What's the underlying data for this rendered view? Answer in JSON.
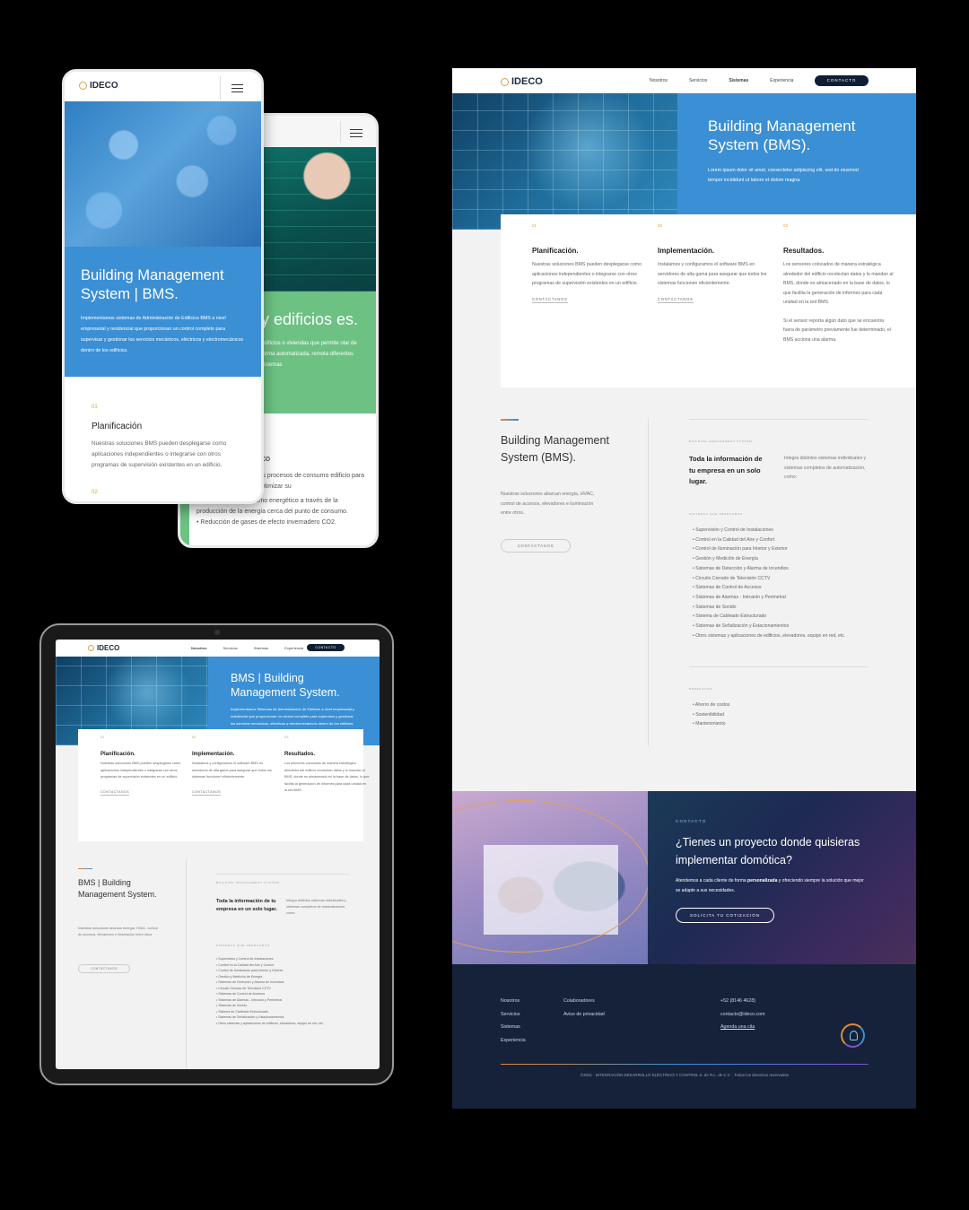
{
  "brand": {
    "logo_text": "IDECO"
  },
  "nav": {
    "links": [
      "Nosotros",
      "Servicios",
      "Sistemas",
      "Experiencia"
    ],
    "contact_button": "CONTACTO"
  },
  "phone_bms": {
    "title": "Building Management System | BMS.",
    "intro": "Implementamos sistemas de Administración de Edificios BMS a nivel empresarial y residencial que proporcionan un control completo para supervisar y gestionar los servicios mecánicos, eléctricos y electromecánicos dentro de los edificios.",
    "card_num_1": "01",
    "card_title": "Planificación",
    "card_text": "Nuestras soluciones BMS pueden desplegarse como aplicaciones independientes o integrarse con otros programas de supervisión existentes en un edificio.",
    "card_num_2": "02"
  },
  "phone_green": {
    "title": "y edificios es.",
    "intro": "edificios o viviendas que permite olar de forma automatizada, remota diferentes sistemas",
    "card_title": "tico",
    "card_text": "los procesos de consumo edificio para optimizar su",
    "bullets": [
      "Reducción del consumo energético a través de la producción de la energía cerca del punto de consumo.",
      "Reducción de gases de efecto invernadero CO2."
    ]
  },
  "tablet": {
    "hero_title": "BMS | Building Management System.",
    "hero_text": "Implementamos Sistemas de Administración de Edificios a nivel empresarial y residencial que proporcionan un control completo para supervisar y gestionar los servicios mecánicos, eléctricos y electromecánicos dentro de los edificios.",
    "section_title": "BMS | Building Management System.",
    "section_desc": "Nuestras soluciones abarcan energía, HVAC, control de accesos, elevadores e iluminación entre otros."
  },
  "desktop": {
    "hero_title": "Building Management System (BMS).",
    "hero_text": "Lorem ipsum dolor sit amet, consectetur adipiscing elit, sed do eiusmod tempor incididunt ut labore et dolore magna.",
    "section_title": "Building Management System (BMS).",
    "section_desc": "Nuestras soluciones abarcan energía, HVAC, control de accesos, elevadores e iluminación entre otros."
  },
  "steps": [
    {
      "num": "01",
      "title": "Planificación.",
      "text": "Nuestras soluciones BMS pueden desplegarse como aplicaciones independientes o integrarse con otros programas de supervisión existentes en un edificio.",
      "link": "CONTÁCTANOS"
    },
    {
      "num": "02",
      "title": "Implementación.",
      "text": "Instalamos y configuramos el software BMS en servidores de alta gama para asegurar que todos los sistemas funcionen eficientemente.",
      "link": "CONTÁCTANOS"
    },
    {
      "num": "03",
      "title": "Resultados.",
      "text": "Los sensores colocados de manera estratégica alrededor del edificio recolectan datos y lo mandan al BMS, donde es almacenado en la base de datos, lo que facilita la generación de informes para cada unidad en la red BMS.",
      "text2": "Si el sensor reporta algún dato que se encuentra fuera de parámetro previamente fue determinado, el BMS acciona una alarma."
    }
  ],
  "tablet_step3_text": "Los sensores colocados de manera estratégica alrededor del edificio recolectan datos y lo mandan al BMS, donde es almacenado en la base de datos, lo que facilita la generación de informes para cada unidad en la red BMS.",
  "section": {
    "contact_button": "CONTÁCTANOS",
    "caption_bms": "BUILDING MANAGEMENT SYSTEM",
    "big_statement": "Toda la información de tu empresa en un solo lugar.",
    "integrates": "Integra distintos sistemas individuales y sistemas completos de automatización, como:",
    "caption_systems": "SISTEMAS QUE ABARCAMOS",
    "systems": [
      "Supervisión y Control de Instalaciones",
      "Control en la Calidad del Aire y Confort",
      "Control de Iluminación para Interior y Exterior",
      "Gestión y Medición de Energía",
      "Sistemas de Detección y Alarma de Incendios",
      "Circuito Cerrado de Televisión CCTV",
      "Sistemas de Control de Accesos",
      "Sistemas de Alarmas - Intrusión y Perimetral",
      "Sistemas de Sonido",
      "Sistema de Cableado Estructurado",
      "Sistemas de Señalización y Estacionamientos",
      "Otros sistemas y aplicaciones de edificios, elevadores, equipo en red, etc."
    ],
    "caption_benefits": "BENEFICIOS",
    "benefits": [
      "Ahorro de costos",
      "Sostenibilidad",
      "Mantenimiento"
    ]
  },
  "cta": {
    "caption": "CONTACTO",
    "title": "¿Tienes un proyecto donde quisieras implementar domótica?",
    "text_before": "Atendemos a cada cliente de forma ",
    "text_bold": "personalizada",
    "text_after": " y ofreciendo siempre la solución que mejor se adapte a sus necesidades.",
    "button": "SOLICITA TU COTIZACIÓN"
  },
  "footer": {
    "col1": [
      "Nosotros",
      "Servicios",
      "Sistemas",
      "Experiencia"
    ],
    "col2": [
      "Colaboradores",
      "Aviso de privacidad"
    ],
    "phone": "+52 (8146 4628)",
    "email": "contacto@ideco.com",
    "appointment": "Agenda una cita",
    "copyright": "©2021 · INTEGRACIÓN DESARROLLO ELÉCTRICO Y CONTROL S. de R.L. de C.V. · Todos los derechos reservados"
  }
}
